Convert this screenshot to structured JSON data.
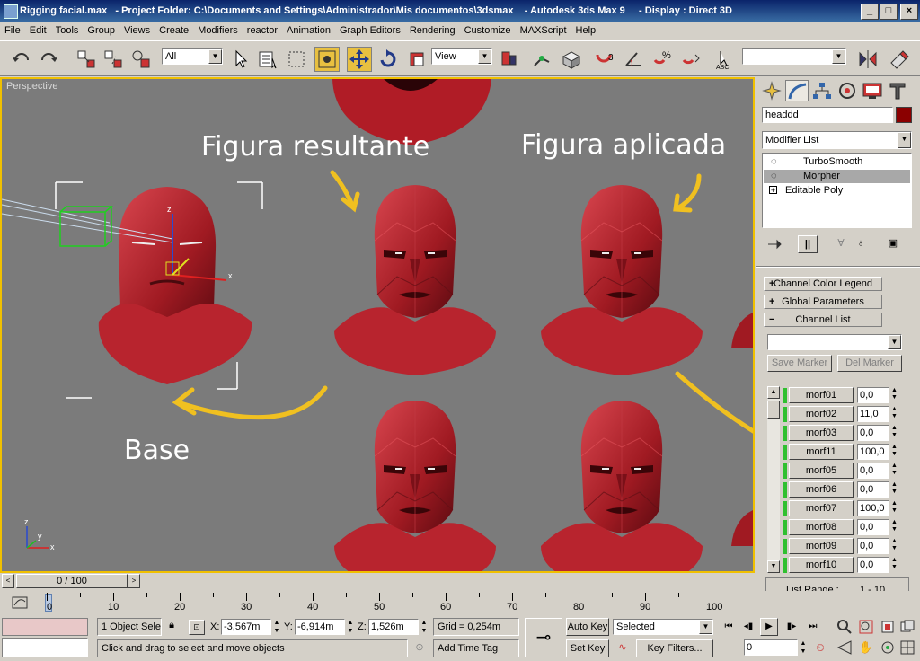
{
  "window": {
    "title": "Rigging facial.max   - Project Folder: C:\\Documents and Settings\\Administrador\\Mis documentos\\3dsmax    - Autodesk 3ds Max 9     - Display : Direct 3D"
  },
  "menu": [
    "File",
    "Edit",
    "Tools",
    "Group",
    "Views",
    "Create",
    "Modifiers",
    "reactor",
    "Animation",
    "Graph Editors",
    "Rendering",
    "Customize",
    "MAXScript",
    "Help"
  ],
  "toolbar": {
    "selection_filter": "All",
    "reference_coord": "View",
    "named_selection": ""
  },
  "viewport": {
    "label": "Perspective",
    "annotations": {
      "resultante": "Figura resultante",
      "aplicada": "Figura aplicada",
      "base": "Base"
    },
    "axis_x": "x",
    "axis_y": "y",
    "axis_z": "z"
  },
  "panel": {
    "object_name": "headdd",
    "object_color": "#8b0000",
    "modifier_list_label": "Modifier List",
    "stack": [
      {
        "label": "TurboSmooth",
        "selected": false
      },
      {
        "label": "Morpher",
        "selected": true
      },
      {
        "label": "Editable Poly",
        "selected": false
      }
    ],
    "rollouts": {
      "legend": "Channel Color Legend",
      "global": "Global Parameters",
      "list": "Channel List"
    },
    "marker_combo": "",
    "save_marker": "Save Marker",
    "del_marker": "Del Marker",
    "channels": [
      {
        "name": "morf01",
        "value": "0,0"
      },
      {
        "name": "morf02",
        "value": "11,0"
      },
      {
        "name": "morf03",
        "value": "0,0"
      },
      {
        "name": "morf11",
        "value": "100,0"
      },
      {
        "name": "morf05",
        "value": "0,0"
      },
      {
        "name": "morf06",
        "value": "0,0"
      },
      {
        "name": "morf07",
        "value": "100,0"
      },
      {
        "name": "morf08",
        "value": "0,0"
      },
      {
        "name": "morf09",
        "value": "0,0"
      },
      {
        "name": "morf10",
        "value": "0,0"
      }
    ],
    "list_range_label": "List Range :",
    "list_range_value": "1 - 10"
  },
  "timeline": {
    "frame_readout": "0 / 100",
    "ticks": [
      "0",
      "10",
      "20",
      "30",
      "40",
      "50",
      "60",
      "70",
      "80",
      "90",
      "100"
    ]
  },
  "status": {
    "selection": "1 Object Sele",
    "x_label": "X:",
    "x_value": "-3,567m",
    "y_label": "Y:",
    "y_value": "-6,914m",
    "z_label": "Z:",
    "z_value": "1,526m",
    "grid": "Grid = 0,254m",
    "prompt": "Click and drag to select and move objects",
    "add_time_tag": "Add Time Tag",
    "auto_key": "Auto Key",
    "set_key": "Set Key",
    "key_mode": "Selected",
    "key_filters": "Key Filters...",
    "current_frame": "0"
  }
}
